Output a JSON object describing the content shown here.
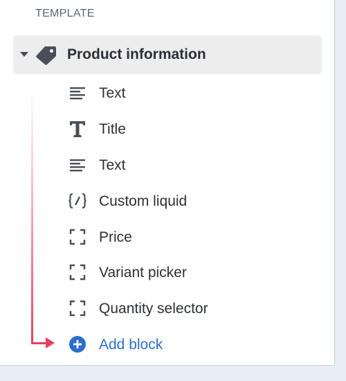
{
  "section_label": "TEMPLATE",
  "section": {
    "title": "Product information",
    "icon": "tag-icon",
    "expanded": true
  },
  "blocks": [
    {
      "label": "Text",
      "icon": "text-lines-icon"
    },
    {
      "label": "Title",
      "icon": "title-t-icon"
    },
    {
      "label": "Text",
      "icon": "text-lines-icon"
    },
    {
      "label": "Custom liquid",
      "icon": "code-braces-icon"
    },
    {
      "label": "Price",
      "icon": "dashed-square-icon"
    },
    {
      "label": "Variant picker",
      "icon": "dashed-square-icon"
    },
    {
      "label": "Quantity selector",
      "icon": "dashed-square-icon"
    }
  ],
  "add_block": {
    "label": "Add block",
    "icon": "plus-circle-icon"
  },
  "colors": {
    "link": "#2c6ecb",
    "accent_arrow": "#e8405a",
    "text": "#2c2f33",
    "icon": "#4a4f57",
    "row_highlight": "#ededee",
    "page_bg": "#e8eef6"
  }
}
